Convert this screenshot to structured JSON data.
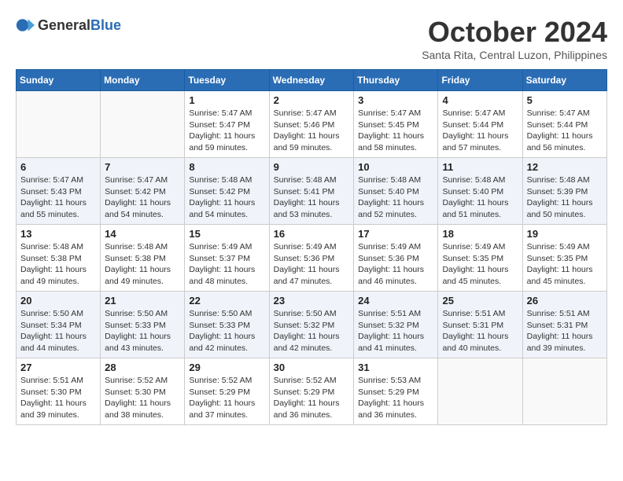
{
  "header": {
    "logo_general": "General",
    "logo_blue": "Blue",
    "month": "October 2024",
    "location": "Santa Rita, Central Luzon, Philippines"
  },
  "weekdays": [
    "Sunday",
    "Monday",
    "Tuesday",
    "Wednesday",
    "Thursday",
    "Friday",
    "Saturday"
  ],
  "weeks": [
    [
      {
        "day": "",
        "empty": true
      },
      {
        "day": "",
        "empty": true
      },
      {
        "day": "1",
        "sunrise": "5:47 AM",
        "sunset": "5:47 PM",
        "daylight": "11 hours and 59 minutes."
      },
      {
        "day": "2",
        "sunrise": "5:47 AM",
        "sunset": "5:46 PM",
        "daylight": "11 hours and 59 minutes."
      },
      {
        "day": "3",
        "sunrise": "5:47 AM",
        "sunset": "5:45 PM",
        "daylight": "11 hours and 58 minutes."
      },
      {
        "day": "4",
        "sunrise": "5:47 AM",
        "sunset": "5:44 PM",
        "daylight": "11 hours and 57 minutes."
      },
      {
        "day": "5",
        "sunrise": "5:47 AM",
        "sunset": "5:44 PM",
        "daylight": "11 hours and 56 minutes."
      }
    ],
    [
      {
        "day": "6",
        "sunrise": "5:47 AM",
        "sunset": "5:43 PM",
        "daylight": "11 hours and 55 minutes."
      },
      {
        "day": "7",
        "sunrise": "5:47 AM",
        "sunset": "5:42 PM",
        "daylight": "11 hours and 54 minutes."
      },
      {
        "day": "8",
        "sunrise": "5:48 AM",
        "sunset": "5:42 PM",
        "daylight": "11 hours and 54 minutes."
      },
      {
        "day": "9",
        "sunrise": "5:48 AM",
        "sunset": "5:41 PM",
        "daylight": "11 hours and 53 minutes."
      },
      {
        "day": "10",
        "sunrise": "5:48 AM",
        "sunset": "5:40 PM",
        "daylight": "11 hours and 52 minutes."
      },
      {
        "day": "11",
        "sunrise": "5:48 AM",
        "sunset": "5:40 PM",
        "daylight": "11 hours and 51 minutes."
      },
      {
        "day": "12",
        "sunrise": "5:48 AM",
        "sunset": "5:39 PM",
        "daylight": "11 hours and 50 minutes."
      }
    ],
    [
      {
        "day": "13",
        "sunrise": "5:48 AM",
        "sunset": "5:38 PM",
        "daylight": "11 hours and 49 minutes."
      },
      {
        "day": "14",
        "sunrise": "5:48 AM",
        "sunset": "5:38 PM",
        "daylight": "11 hours and 49 minutes."
      },
      {
        "day": "15",
        "sunrise": "5:49 AM",
        "sunset": "5:37 PM",
        "daylight": "11 hours and 48 minutes."
      },
      {
        "day": "16",
        "sunrise": "5:49 AM",
        "sunset": "5:36 PM",
        "daylight": "11 hours and 47 minutes."
      },
      {
        "day": "17",
        "sunrise": "5:49 AM",
        "sunset": "5:36 PM",
        "daylight": "11 hours and 46 minutes."
      },
      {
        "day": "18",
        "sunrise": "5:49 AM",
        "sunset": "5:35 PM",
        "daylight": "11 hours and 45 minutes."
      },
      {
        "day": "19",
        "sunrise": "5:49 AM",
        "sunset": "5:35 PM",
        "daylight": "11 hours and 45 minutes."
      }
    ],
    [
      {
        "day": "20",
        "sunrise": "5:50 AM",
        "sunset": "5:34 PM",
        "daylight": "11 hours and 44 minutes."
      },
      {
        "day": "21",
        "sunrise": "5:50 AM",
        "sunset": "5:33 PM",
        "daylight": "11 hours and 43 minutes."
      },
      {
        "day": "22",
        "sunrise": "5:50 AM",
        "sunset": "5:33 PM",
        "daylight": "11 hours and 42 minutes."
      },
      {
        "day": "23",
        "sunrise": "5:50 AM",
        "sunset": "5:32 PM",
        "daylight": "11 hours and 42 minutes."
      },
      {
        "day": "24",
        "sunrise": "5:51 AM",
        "sunset": "5:32 PM",
        "daylight": "11 hours and 41 minutes."
      },
      {
        "day": "25",
        "sunrise": "5:51 AM",
        "sunset": "5:31 PM",
        "daylight": "11 hours and 40 minutes."
      },
      {
        "day": "26",
        "sunrise": "5:51 AM",
        "sunset": "5:31 PM",
        "daylight": "11 hours and 39 minutes."
      }
    ],
    [
      {
        "day": "27",
        "sunrise": "5:51 AM",
        "sunset": "5:30 PM",
        "daylight": "11 hours and 39 minutes."
      },
      {
        "day": "28",
        "sunrise": "5:52 AM",
        "sunset": "5:30 PM",
        "daylight": "11 hours and 38 minutes."
      },
      {
        "day": "29",
        "sunrise": "5:52 AM",
        "sunset": "5:29 PM",
        "daylight": "11 hours and 37 minutes."
      },
      {
        "day": "30",
        "sunrise": "5:52 AM",
        "sunset": "5:29 PM",
        "daylight": "11 hours and 36 minutes."
      },
      {
        "day": "31",
        "sunrise": "5:53 AM",
        "sunset": "5:29 PM",
        "daylight": "11 hours and 36 minutes."
      },
      {
        "day": "",
        "empty": true
      },
      {
        "day": "",
        "empty": true
      }
    ]
  ]
}
